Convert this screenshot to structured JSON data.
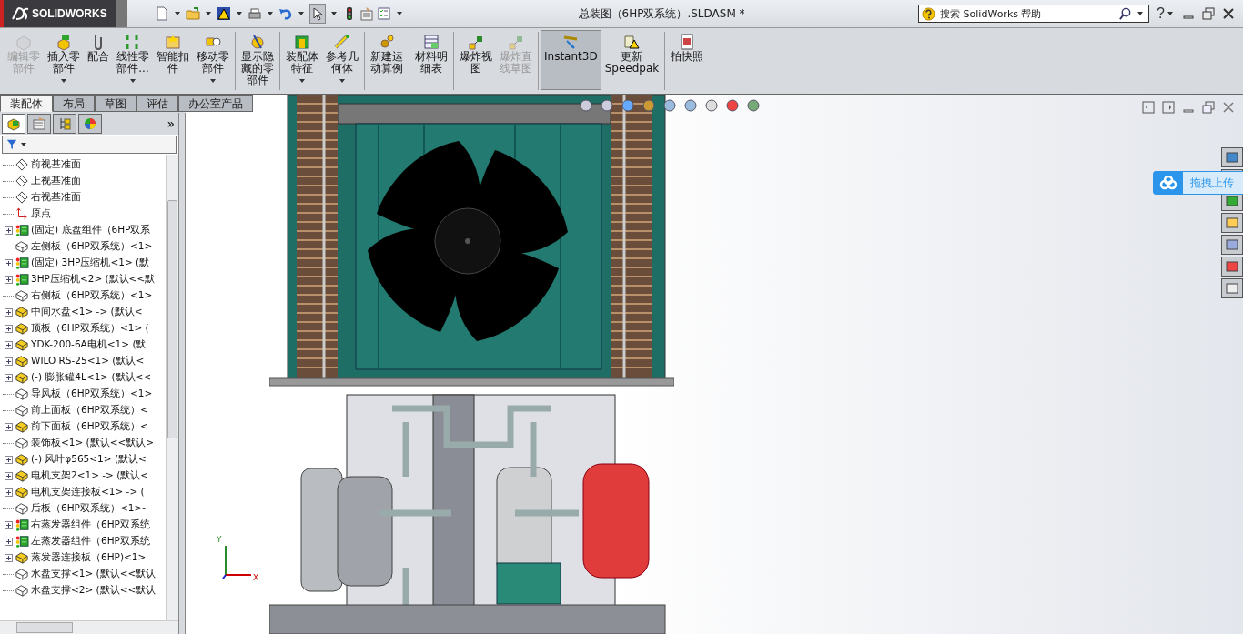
{
  "app": {
    "logo": "SOLIDWORKS",
    "title": "总装图（6HP双系统）.SLDASM *"
  },
  "search": {
    "placeholder": "搜索 SolidWorks 帮助"
  },
  "help": {
    "label": "?"
  },
  "command_groups": [
    {
      "commands": [
        {
          "lines": [
            "编辑零",
            "部件"
          ],
          "disabled": true,
          "dropdown": false,
          "selected": false,
          "kind": "edit"
        },
        {
          "lines": [
            "插入零",
            "部件"
          ],
          "disabled": false,
          "dropdown": true,
          "selected": false,
          "kind": "insert"
        },
        {
          "lines": [
            "配合"
          ],
          "disabled": false,
          "dropdown": false,
          "selected": false,
          "kind": "mate"
        },
        {
          "lines": [
            "线性零",
            "部件..."
          ],
          "disabled": false,
          "dropdown": true,
          "selected": false,
          "kind": "pattern"
        },
        {
          "lines": [
            "智能扣",
            "件"
          ],
          "disabled": false,
          "dropdown": false,
          "selected": false,
          "kind": "fastener"
        },
        {
          "lines": [
            "移动零",
            "部件"
          ],
          "disabled": false,
          "dropdown": true,
          "selected": false,
          "kind": "move"
        }
      ]
    },
    {
      "commands": [
        {
          "lines": [
            "显示隐",
            "藏的零",
            "部件"
          ],
          "disabled": false,
          "dropdown": false,
          "selected": false,
          "kind": "show"
        }
      ]
    },
    {
      "commands": [
        {
          "lines": [
            "装配体",
            "特征"
          ],
          "disabled": false,
          "dropdown": true,
          "selected": false,
          "kind": "feature"
        },
        {
          "lines": [
            "参考几",
            "何体"
          ],
          "disabled": false,
          "dropdown": true,
          "selected": false,
          "kind": "reference"
        }
      ]
    },
    {
      "commands": [
        {
          "lines": [
            "新建运",
            "动算例"
          ],
          "disabled": false,
          "dropdown": false,
          "selected": false,
          "kind": "motion"
        }
      ]
    },
    {
      "commands": [
        {
          "lines": [
            "材料明",
            "细表"
          ],
          "disabled": false,
          "dropdown": false,
          "selected": false,
          "kind": "bom"
        }
      ]
    },
    {
      "commands": [
        {
          "lines": [
            "爆炸视",
            "图"
          ],
          "disabled": false,
          "dropdown": false,
          "selected": false,
          "kind": "explode"
        },
        {
          "lines": [
            "爆炸直",
            "线草图"
          ],
          "disabled": true,
          "dropdown": false,
          "selected": false,
          "kind": "explode"
        }
      ]
    },
    {
      "commands": [
        {
          "lines": [
            "Instant3D"
          ],
          "disabled": false,
          "dropdown": false,
          "selected": true,
          "kind": "instant3d"
        },
        {
          "lines": [
            "更新",
            "Speedpak"
          ],
          "disabled": false,
          "dropdown": false,
          "selected": false,
          "kind": "speedpak"
        }
      ]
    },
    {
      "commands": [
        {
          "lines": [
            "拍快照"
          ],
          "disabled": false,
          "dropdown": false,
          "selected": false,
          "kind": "snapshot"
        }
      ]
    }
  ],
  "tabs": [
    {
      "label": "装配体",
      "selected": true
    },
    {
      "label": "布局",
      "selected": false
    },
    {
      "label": "草图",
      "selected": false
    },
    {
      "label": "评估",
      "selected": false
    },
    {
      "label": "办公室产品",
      "selected": false
    }
  ],
  "panel_tabs": [
    {
      "kind": "tree",
      "selected": true
    },
    {
      "kind": "properties",
      "selected": false
    },
    {
      "kind": "config",
      "selected": false
    },
    {
      "kind": "appearance",
      "selected": false
    }
  ],
  "tree": [
    {
      "kind": "plane",
      "label": "前视基准面",
      "expandable": false
    },
    {
      "kind": "plane",
      "label": "上视基准面",
      "expandable": false
    },
    {
      "kind": "plane",
      "label": "右视基准面",
      "expandable": false
    },
    {
      "kind": "origin",
      "label": "原点",
      "expandable": false
    },
    {
      "kind": "assembly",
      "label": "(固定) 底盘组件（6HP双系",
      "expandable": true
    },
    {
      "kind": "part",
      "label": "左侧板（6HP双系统）<1>",
      "expandable": false
    },
    {
      "kind": "assembly",
      "label": "(固定) 3HP压缩机<1> (默",
      "expandable": true
    },
    {
      "kind": "assembly",
      "label": "3HP压缩机<2> (默认<<默",
      "expandable": true
    },
    {
      "kind": "part",
      "label": "右侧板（6HP双系统）<1>",
      "expandable": false
    },
    {
      "kind": "subpart",
      "label": "中间水盘<1> -> (默认<",
      "expandable": true
    },
    {
      "kind": "subpart",
      "label": "顶板（6HP双系统）<1> (",
      "expandable": true
    },
    {
      "kind": "subpart",
      "label": "YDK-200-6A电机<1> (默",
      "expandable": true
    },
    {
      "kind": "subpart",
      "label": "WILO RS-25<1> (默认<",
      "expandable": true
    },
    {
      "kind": "subpart",
      "label": "(-) 膨胀罐4L<1> (默认<<",
      "expandable": true
    },
    {
      "kind": "part",
      "label": "导风板（6HP双系统）<1>",
      "expandable": false
    },
    {
      "kind": "part",
      "label": "前上面板（6HP双系统）<",
      "expandable": false
    },
    {
      "kind": "subpart",
      "label": "前下面板（6HP双系统）<",
      "expandable": true
    },
    {
      "kind": "part",
      "label": "装饰板<1> (默认<<默认>",
      "expandable": false
    },
    {
      "kind": "subpart",
      "label": "(-) 风叶φ565<1> (默认<",
      "expandable": true
    },
    {
      "kind": "subpart",
      "label": "电机支架2<1> -> (默认<",
      "expandable": true
    },
    {
      "kind": "subpart",
      "label": "电机支架连接板<1> -> (",
      "expandable": true
    },
    {
      "kind": "part",
      "label": "后板（6HP双系统）<1>-",
      "expandable": false
    },
    {
      "kind": "assembly",
      "label": "右蒸发器组件（6HP双系统",
      "expandable": true
    },
    {
      "kind": "assembly",
      "label": "左蒸发器组件（6HP双系统",
      "expandable": true
    },
    {
      "kind": "subpart",
      "label": "蒸发器连接板（6HP)<1>",
      "expandable": true
    },
    {
      "kind": "part",
      "label": "水盘支撑<1> (默认<<默认",
      "expandable": false
    },
    {
      "kind": "part",
      "label": "水盘支撑<2> (默认<<默认",
      "expandable": false
    }
  ],
  "panel_more": {
    "label": "»"
  },
  "triad": {
    "y": "Y",
    "x": "X"
  },
  "upload_widget": {
    "label": "拖拽上传"
  }
}
